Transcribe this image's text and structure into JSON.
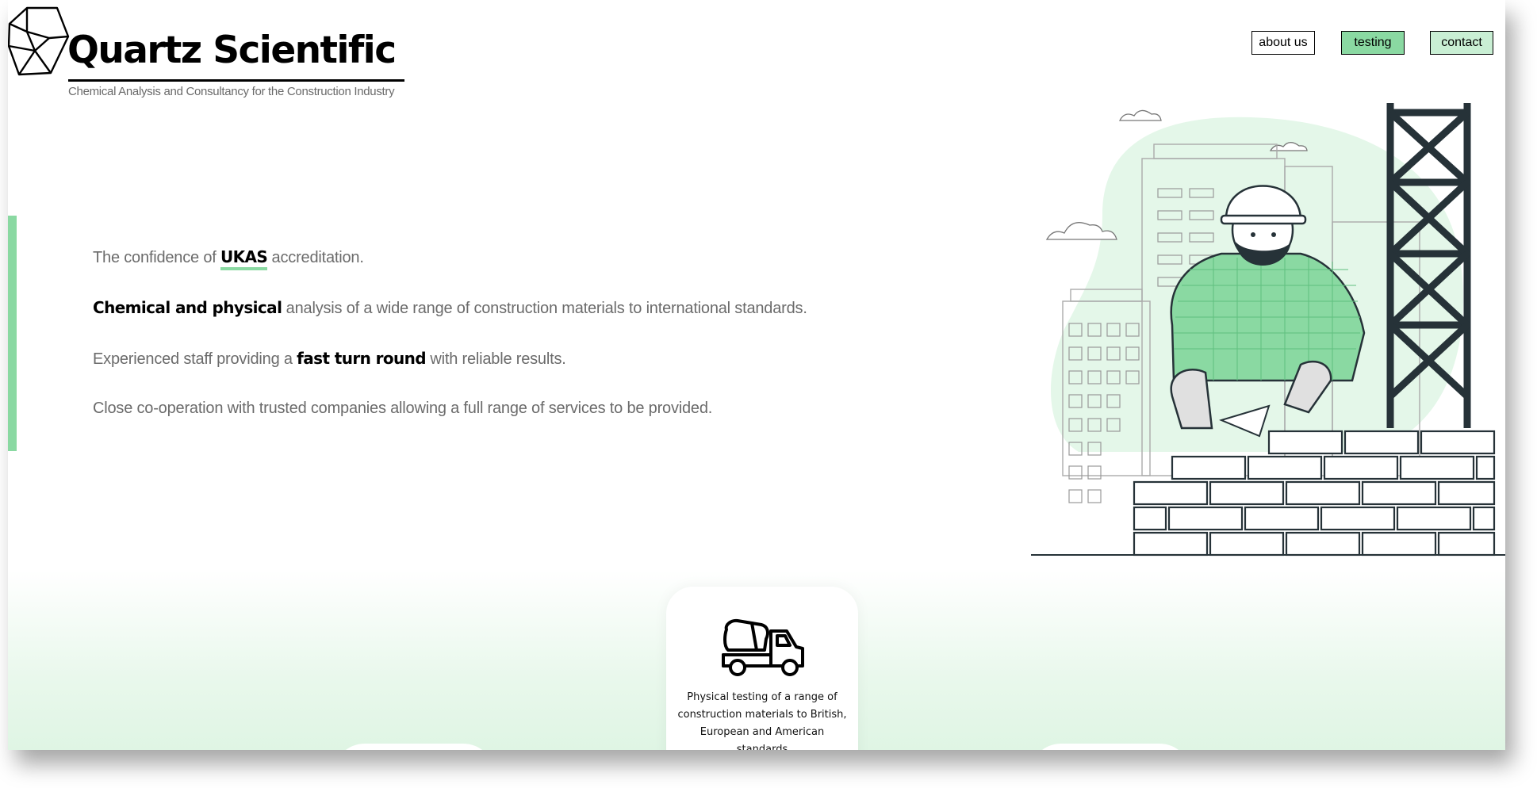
{
  "brand": {
    "title": "Quartz Scientific",
    "tagline": "Chemical Analysis and Consultancy for the Construction Industry",
    "logo_icon": "quartz-crystal-icon"
  },
  "nav": {
    "about": "about us",
    "testing": "testing",
    "contact": "contact"
  },
  "hero": {
    "line1": {
      "before": "The confidence of ",
      "strong": "UKAS",
      "after": " accreditation."
    },
    "line2": {
      "strong": "Chemical and physical",
      "after": " analysis of a wide range of construction materials to international standards."
    },
    "line3": {
      "before": "Experienced staff providing a ",
      "strong": "fast turn round",
      "after": " with reliable results."
    },
    "line4": {
      "text": "Close co-operation with trusted companies allowing a full range of services to be provided."
    }
  },
  "illustration": {
    "icon": "bricklayer-illustration"
  },
  "services": [
    {
      "icon": "cement-mixer-truck-icon",
      "text": "Physical testing of a range of construction materials to British, European and American standards"
    }
  ],
  "colors": {
    "accent": "#8ad9a2",
    "accent_light": "#c9efd4",
    "text_muted": "#6b6b6b",
    "ink": "#000000"
  }
}
